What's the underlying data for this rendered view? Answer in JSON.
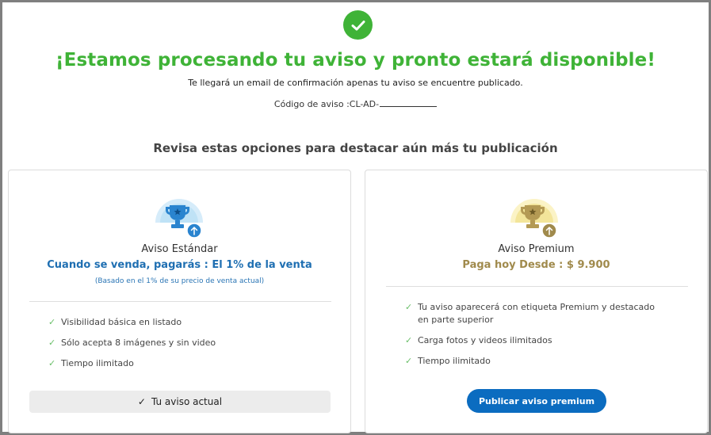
{
  "header": {
    "success_icon": "check-circle-icon",
    "title": "¡Estamos procesando tu aviso y pronto estará disponible!",
    "subtitle": "Te llegará un email de confirmación apenas tu aviso se encuentre publicado.",
    "code_label": "Código de aviso :CL-AD-"
  },
  "section_title": "Revisa estas opciones para destacar aún más tu publicación",
  "standard": {
    "icon": "trophy-blue-icon",
    "name": "Aviso Estándar",
    "price_line": "Cuando se venda, pagarás : El 1% de la venta",
    "note": "(Basado en el 1% de su precio de venta actual)",
    "features": [
      "Visibilidad básica en listado",
      "Sólo acepta 8 imágenes y sin video",
      "Tiempo ilimitado"
    ],
    "button_label": "Tu aviso actual",
    "color": "#1f6fb2"
  },
  "premium": {
    "icon": "trophy-gold-icon",
    "name": "Aviso Premium",
    "price_line": "Paga hoy Desde : $ 9.900",
    "features": [
      "Tu aviso aparecerá con etiqueta Premium y destacado en parte superior",
      "Carga fotos y videos ilimitados",
      "Tiempo ilimitado"
    ],
    "button_label": "Publicar aviso premium",
    "color": "#a08a4c"
  },
  "colors": {
    "success": "#3fb337",
    "primary_button": "#0b6cc0",
    "check": "#6abf69"
  }
}
